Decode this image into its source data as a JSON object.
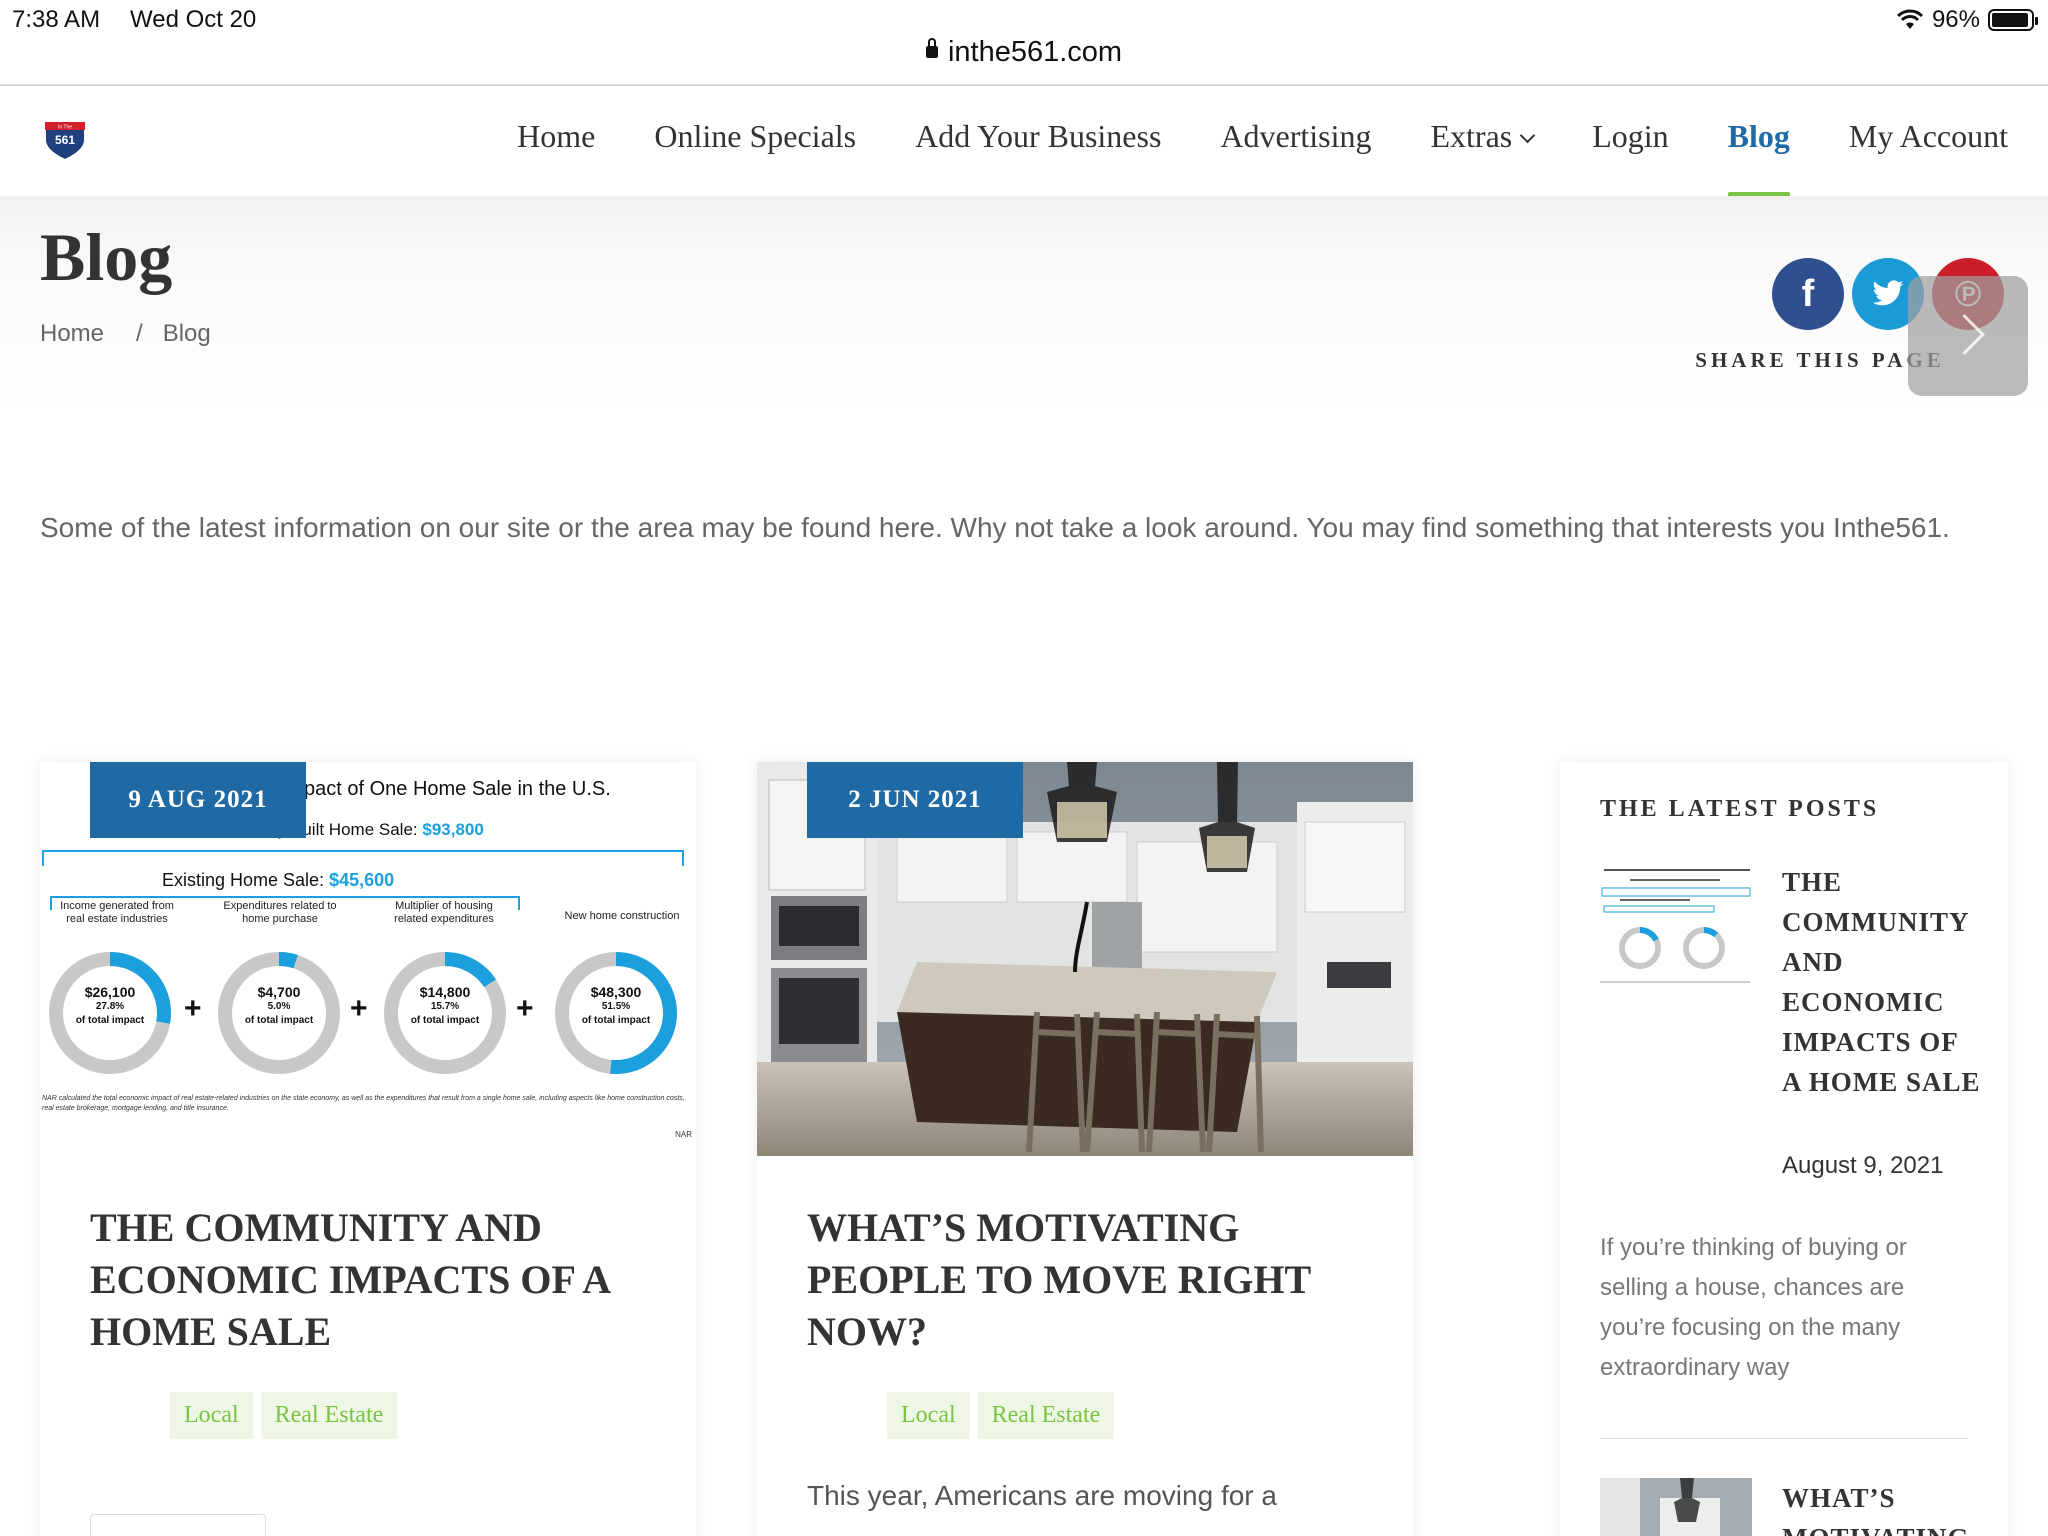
{
  "status_bar": {
    "time": "7:38 AM",
    "date": "Wed Oct 20",
    "battery": "96%",
    "battery_level": 0.96
  },
  "browser": {
    "url": "inthe561.com"
  },
  "nav": {
    "logo_text_top": "In The",
    "logo_text": "561",
    "items": [
      {
        "label": "Home",
        "active": false
      },
      {
        "label": "Online Specials",
        "active": false
      },
      {
        "label": "Add Your Business",
        "active": false
      },
      {
        "label": "Advertising",
        "active": false
      },
      {
        "label": "Extras",
        "active": false,
        "has_dropdown": true
      },
      {
        "label": "Login",
        "active": false
      },
      {
        "label": "Blog",
        "active": true
      },
      {
        "label": "My Account",
        "active": false
      }
    ]
  },
  "header": {
    "title": "Blog",
    "breadcrumb": {
      "home": "Home",
      "separator": "/",
      "current": "Blog"
    },
    "share": {
      "label": "SHARE THIS PAGE",
      "facebook_glyph": "f",
      "pinterest_glyph": "℗"
    }
  },
  "intro": {
    "text": "Some of the latest information on our site or the area may be found here. Why not take a look around. You may find something that interests you Inthe561."
  },
  "posts": [
    {
      "date": "9 AUG 2021",
      "title": "THE COMMUNITY AND ECONOMIC IMPACTS OF A HOME SALE",
      "tags": [
        "Local",
        "Real Estate"
      ],
      "image": {
        "title": "pact of One Home Sale in the U.S.",
        "newly_built_label": "Newly Built Home Sale:",
        "newly_built_value": "$93,800",
        "existing_label": "Existing Home Sale:",
        "existing_value": "$45,600",
        "captions": [
          "Income generated from real estate industries",
          "Expenditures related to home purchase",
          "Multiplier of housing related expenditures",
          "New home construction"
        ],
        "donuts": [
          {
            "value": "$26,100",
            "pct": "27.8%",
            "pct_value": 0.278,
            "sub": "of total impact"
          },
          {
            "value": "$4,700",
            "pct": "5.0%",
            "pct_value": 0.05,
            "sub": "of total impact"
          },
          {
            "value": "$14,800",
            "pct": "15.7%",
            "pct_value": 0.157,
            "sub": "of total impact"
          },
          {
            "value": "$48,300",
            "pct": "51.5%",
            "pct_value": 0.515,
            "sub": "of total impact"
          }
        ],
        "plus": "+",
        "footnote": "NAR calculated the total economic impact of real estate-related industries on the state economy, as well as the expenditures that result from a single home sale, including aspects like home construction costs, real estate brokerage, mortgage lending, and title insurance.",
        "source": "NAR"
      }
    },
    {
      "date": "2 JUN 2021",
      "title": "WHAT’S MOTIVATING PEOPLE TO MOVE RIGHT NOW?",
      "tags": [
        "Local",
        "Real Estate"
      ],
      "excerpt": "This year, Americans are moving for a"
    }
  ],
  "sidebar": {
    "heading": "THE LATEST POSTS",
    "posts": [
      {
        "title": "THE COMMUNITY AND ECONOMIC IMPACTS OF A HOME SALE",
        "date": "August 9, 2021",
        "excerpt": "If you’re thinking of buying or selling a house, chances are you’re focusing on the many extraordinary way"
      },
      {
        "title": "WHAT’S MOTIVATING"
      }
    ]
  },
  "colors": {
    "accent": "#1f6aa5",
    "active_underline": "#7cc243",
    "tag_text": "#7cc243",
    "tag_bg": "#eef7e6",
    "infographic_blue": "#1ba0dd"
  }
}
